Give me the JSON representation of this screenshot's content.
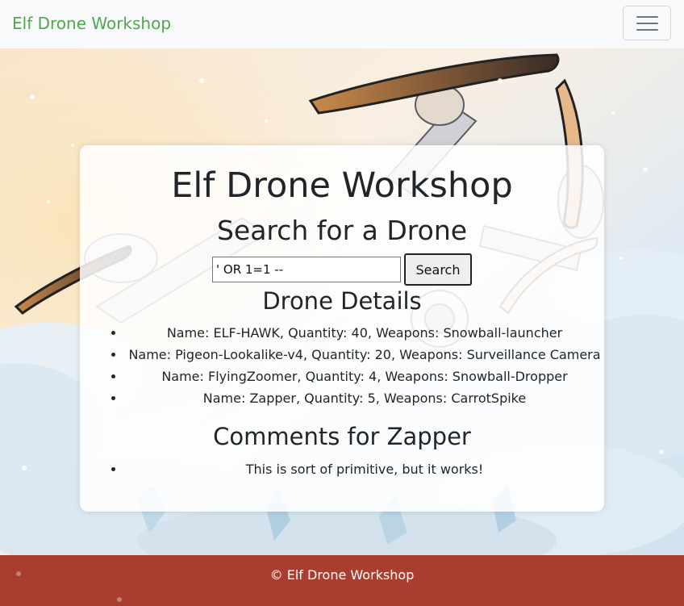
{
  "navbar": {
    "brand": "Elf Drone Workshop",
    "toggler_icon": "hamburger-menu-icon"
  },
  "main": {
    "title": "Elf Drone Workshop",
    "search_heading": "Search for a Drone",
    "search": {
      "value": "' OR 1=1 --",
      "button_label": "Search"
    },
    "details_heading": "Drone Details",
    "drones": [
      "Name: ELF-HAWK, Quantity: 40, Weapons: Snowball-launcher",
      "Name: Pigeon-Lookalike-v4, Quantity: 20, Weapons: Surveillance Camera",
      "Name: FlyingZoomer, Quantity: 4, Weapons: Snowball-Dropper",
      "Name: Zapper, Quantity: 5, Weapons: CarrotSpike"
    ],
    "comments_heading": "Comments for Zapper",
    "comments": [
      "This is sort of primitive, but it works!"
    ]
  },
  "footer": {
    "text": "© Elf Drone Workshop"
  },
  "colors": {
    "brand": "#4fa84a",
    "footer_bg": "#a83e2f",
    "navbar_bg": "#f8f9fa"
  }
}
